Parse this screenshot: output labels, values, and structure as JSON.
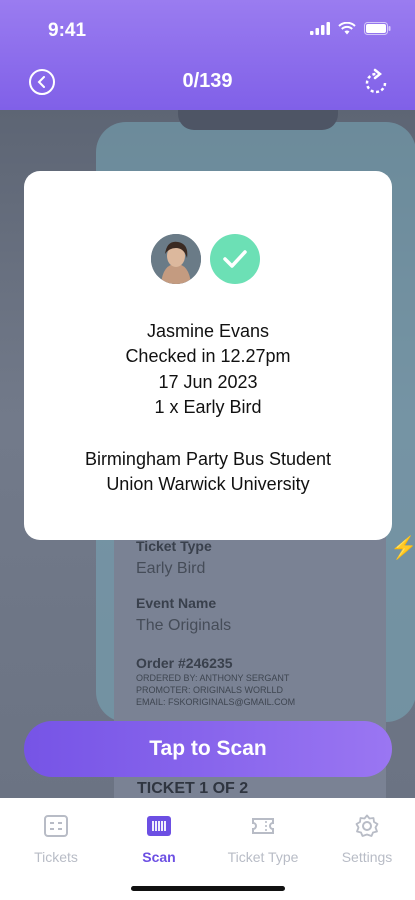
{
  "status": {
    "time": "9:41"
  },
  "header": {
    "title": "0/139"
  },
  "background": {
    "ticket_type_label": "Ticket Type",
    "ticket_type_value": "Early Bird",
    "event_name_label": "Event Name",
    "event_name_value": "The Originals",
    "order_label": "Order #246235",
    "ordered_by": "ORDERED BY: ANTHONY SERGANT",
    "promoter": "PROMOTER: ORIGINALS WORLLD",
    "email": "EMAIL: FSKORIGINALS@GMAIL.COM",
    "ticket_count": "TICKET 1 OF 2"
  },
  "modal": {
    "name": "Jasmine Evans",
    "checked_in": "Checked in 12.27pm",
    "date": "17 Jun 2023",
    "ticket": "1 x Early Bird",
    "event_line1": "Birmingham Party Bus Student",
    "event_line2": "Union Warwick University"
  },
  "scan_button": {
    "label": "Tap to Scan"
  },
  "tabs": [
    {
      "label": "Tickets",
      "icon": "tickets-icon",
      "active": false
    },
    {
      "label": "Scan",
      "icon": "scan-icon",
      "active": true
    },
    {
      "label": "Ticket Type",
      "icon": "ticket-type-icon",
      "active": false
    },
    {
      "label": "Settings",
      "icon": "settings-icon",
      "active": false
    }
  ],
  "colors": {
    "accent": "#6c4fe3",
    "success": "#6ce0b5",
    "header": "#8b6cf0"
  }
}
